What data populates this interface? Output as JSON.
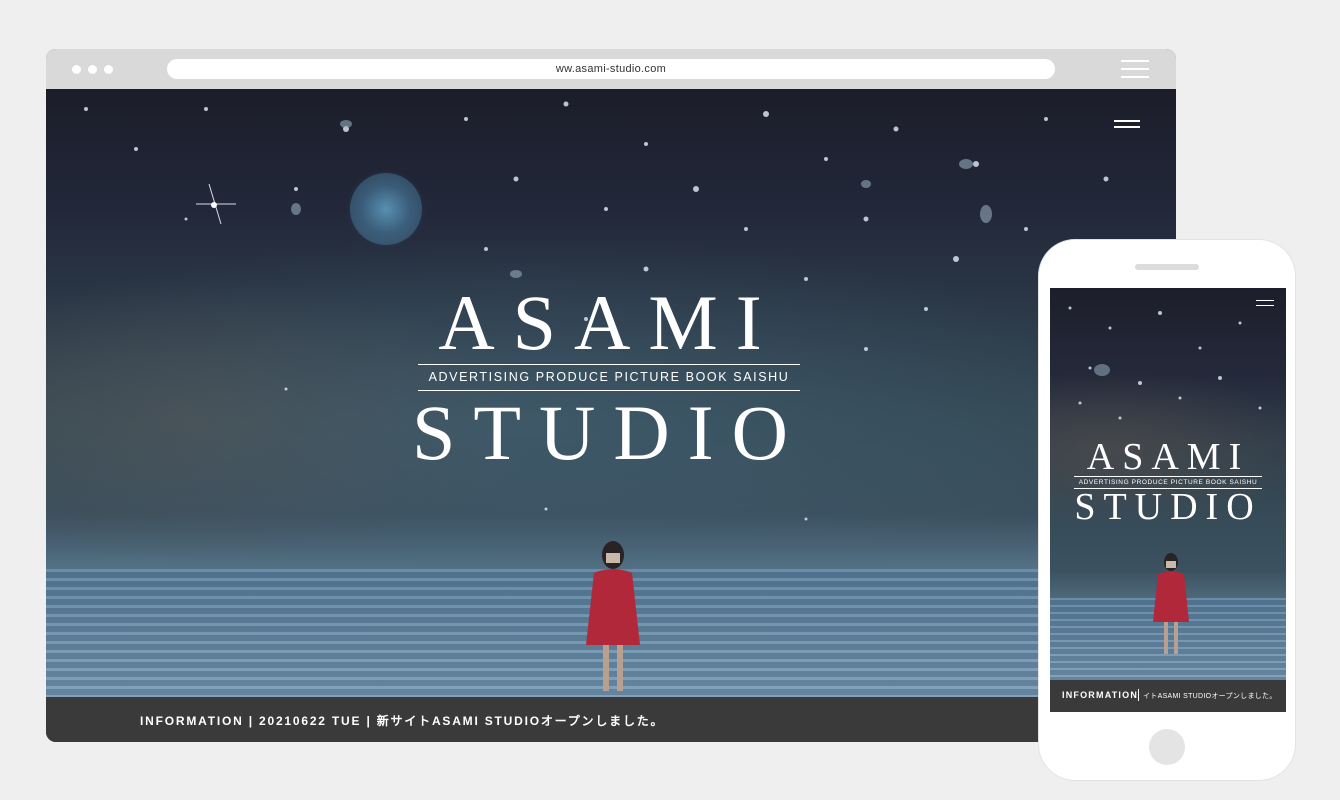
{
  "browser": {
    "url": "ww.asami-studio.com",
    "menu_icon": "hamburger-icon"
  },
  "site": {
    "logo_top": "ASAMI",
    "logo_tagline": "ADVERTISING  PRODUCE  PICTURE BOOK  SAISHU",
    "logo_bottom": "STUDIO",
    "menu_icon": "hamburger-icon",
    "info_text": "INFORMATION | 20210622 TUE | 新サイトASAMI STUDIOオープンしました。"
  },
  "phone": {
    "logo_top": "ASAMI",
    "logo_tagline": "ADVERTISING  PRODUCE  PICTURE BOOK  SAISHU",
    "logo_bottom": "STUDIO",
    "info_label": "INFORMATION",
    "info_message": "イトASAMI STUDIOオープンしました。",
    "menu_icon": "hamburger-icon"
  },
  "colors": {
    "page_bg": "#efefef",
    "browser_chrome": "#d9d9d9",
    "info_bar": "#3a3a3a",
    "girl_dress": "#b0283a"
  }
}
